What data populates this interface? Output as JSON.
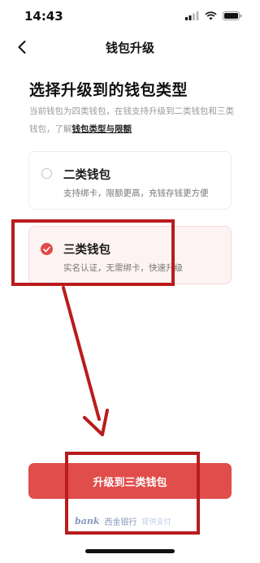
{
  "status_bar": {
    "time": "14:43"
  },
  "nav": {
    "title": "钱包升级"
  },
  "page": {
    "heading": "选择升级到的钱包类型",
    "description": "当前钱包为四类钱包，在钱支持升级到二类钱包和三类钱包，了解",
    "description_link": "钱包类型与限额"
  },
  "options": [
    {
      "title": "二类钱包",
      "subtitle": "支持绑卡，限额更高，充钱存钱更方便",
      "selected": false
    },
    {
      "title": "三类钱包",
      "subtitle": "实名认证，无需绑卡，快速升级",
      "selected": true
    }
  ],
  "cta": {
    "label": "升级到三类钱包"
  },
  "footer": {
    "logo_text": "bank",
    "bank_name": "西金银行",
    "tag": "提供支付"
  },
  "colors": {
    "accent": "#e04d4a",
    "annotation": "#b91c1c"
  },
  "icons": {
    "back": "chevron-left-icon",
    "signal": "cellular-signal-icon",
    "wifi": "wifi-icon",
    "battery": "battery-icon",
    "check": "checkmark-icon",
    "arrow": "annotation-arrow"
  }
}
